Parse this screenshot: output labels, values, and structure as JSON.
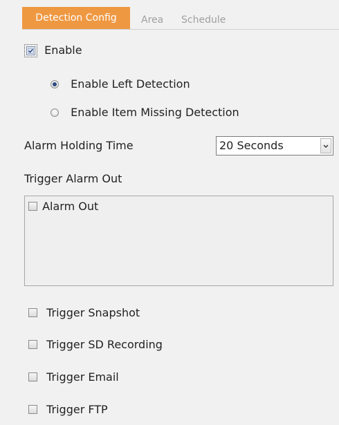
{
  "tabs": {
    "detection_config": "Detection Config",
    "area": "Area",
    "schedule": "Schedule"
  },
  "enable": {
    "label": "Enable",
    "checked": true
  },
  "detection_mode": {
    "options": [
      {
        "label": "Enable Left Detection",
        "selected": true
      },
      {
        "label": "Enable Item Missing Detection",
        "selected": false
      }
    ]
  },
  "alarm_holding_time": {
    "label": "Alarm Holding Time",
    "value": "20 Seconds"
  },
  "trigger_alarm_out": {
    "label": "Trigger Alarm Out",
    "items": [
      {
        "label": "Alarm Out",
        "checked": false
      }
    ]
  },
  "triggers": [
    {
      "label": "Trigger Snapshot",
      "checked": false
    },
    {
      "label": "Trigger SD Recording",
      "checked": false
    },
    {
      "label": "Trigger Email",
      "checked": false
    },
    {
      "label": "Trigger FTP",
      "checked": false
    }
  ],
  "colors": {
    "accent": "#ef9842",
    "background": "#f1f1f1",
    "inactive_tab": "#a0a0a0"
  }
}
